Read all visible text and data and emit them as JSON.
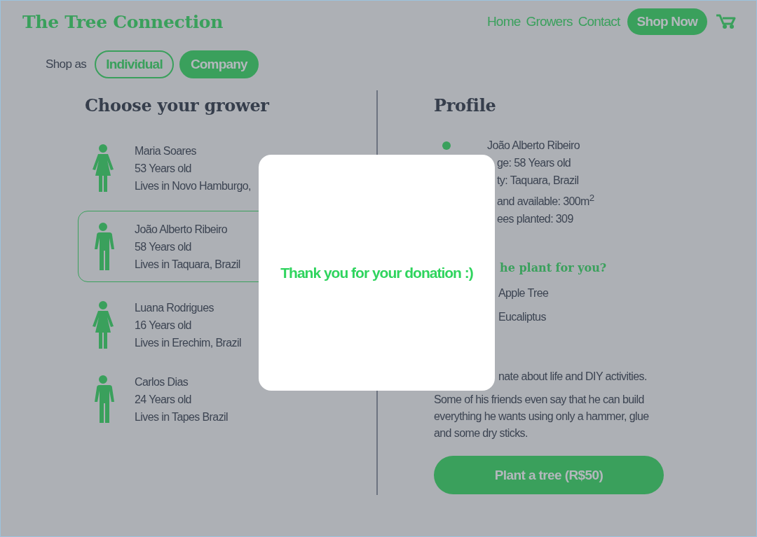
{
  "header": {
    "logo": "The Tree Connection",
    "nav": [
      {
        "label": "Home"
      },
      {
        "label": "Growers"
      },
      {
        "label": "Contact"
      }
    ],
    "cta": "Shop Now"
  },
  "shop_as": {
    "label": "Shop as",
    "options": [
      {
        "label": "Individual",
        "selected": false
      },
      {
        "label": "Company",
        "selected": true
      }
    ]
  },
  "growers": {
    "title": "Choose your grower",
    "items": [
      {
        "name": "Maria Soares",
        "age": "53 Years old",
        "location": "Lives in Novo Hamburgo,",
        "kind": "woman",
        "selected": false
      },
      {
        "name": "João Alberto Ribeiro",
        "age": "58 Years old",
        "location": "Lives in Taquara, Brazil",
        "kind": "man",
        "selected": true
      },
      {
        "name": "Luana Rodrigues",
        "age": "16 Years old",
        "location": "Lives in Erechim, Brazil",
        "kind": "woman",
        "selected": false
      },
      {
        "name": "Carlos Dias",
        "age": "24 Years old",
        "location": "Lives in Tapes Brazil",
        "kind": "man",
        "selected": false
      }
    ]
  },
  "profile": {
    "title": "Profile",
    "name": "João Alberto Ribeiro",
    "details": [
      "ge: 58 Years old",
      "ty: Taquara, Brazil",
      "and available: 300m$^{2}$",
      "ees planted: 309"
    ],
    "plants_title": "he plant for you?",
    "plants": [
      "Apple Tree",
      "Eucaliptus"
    ],
    "bio_fragment": "nate about life and DIY activities.",
    "bio": "Some of his friends even say that he can build everything he wants using only a hammer, glue and some dry sticks.",
    "button": "Plant a tree (R$50)"
  },
  "modal": {
    "message": "Thank you for your donation :)"
  }
}
